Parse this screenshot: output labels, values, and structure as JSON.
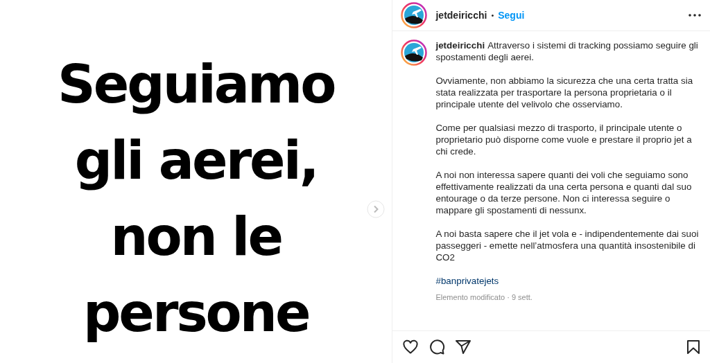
{
  "post_image": {
    "lines": [
      "Seguiamo",
      "gli aerei,",
      "non le",
      "persone"
    ]
  },
  "header": {
    "username": "jetdeiricchi",
    "separator": "•",
    "follow": "Segui"
  },
  "caption": {
    "username": "jetdeiricchi",
    "paragraphs": [
      "Attraverso i sistemi di tracking possiamo seguire gli spostamenti degli aerei.",
      "Ovviamente, non abbiamo la sicurezza che una certa tratta sia stata realizzata per trasportare la persona proprietaria o il principale utente del velivolo che osserviamo.",
      "Come per qualsiasi mezzo di trasporto, il principale utente o proprietario può disporne come vuole e prestare il proprio jet a chi crede.",
      "A noi non interessa sapere quanti dei voli che seguiamo sono effettivamente realizzati da una certa persona e quanti dal suo entourage o da terze persone. Non ci interessa seguire o mappare gli spostamenti di nessunx.",
      "A noi basta sapere che il jet vola e - indipendentemente dai suoi passeggeri - emette nell’atmosfera una quantità insostenibile di CO2"
    ],
    "hashtag": "#banprivatejets",
    "meta": "Elemento modificato · 9 sett."
  }
}
